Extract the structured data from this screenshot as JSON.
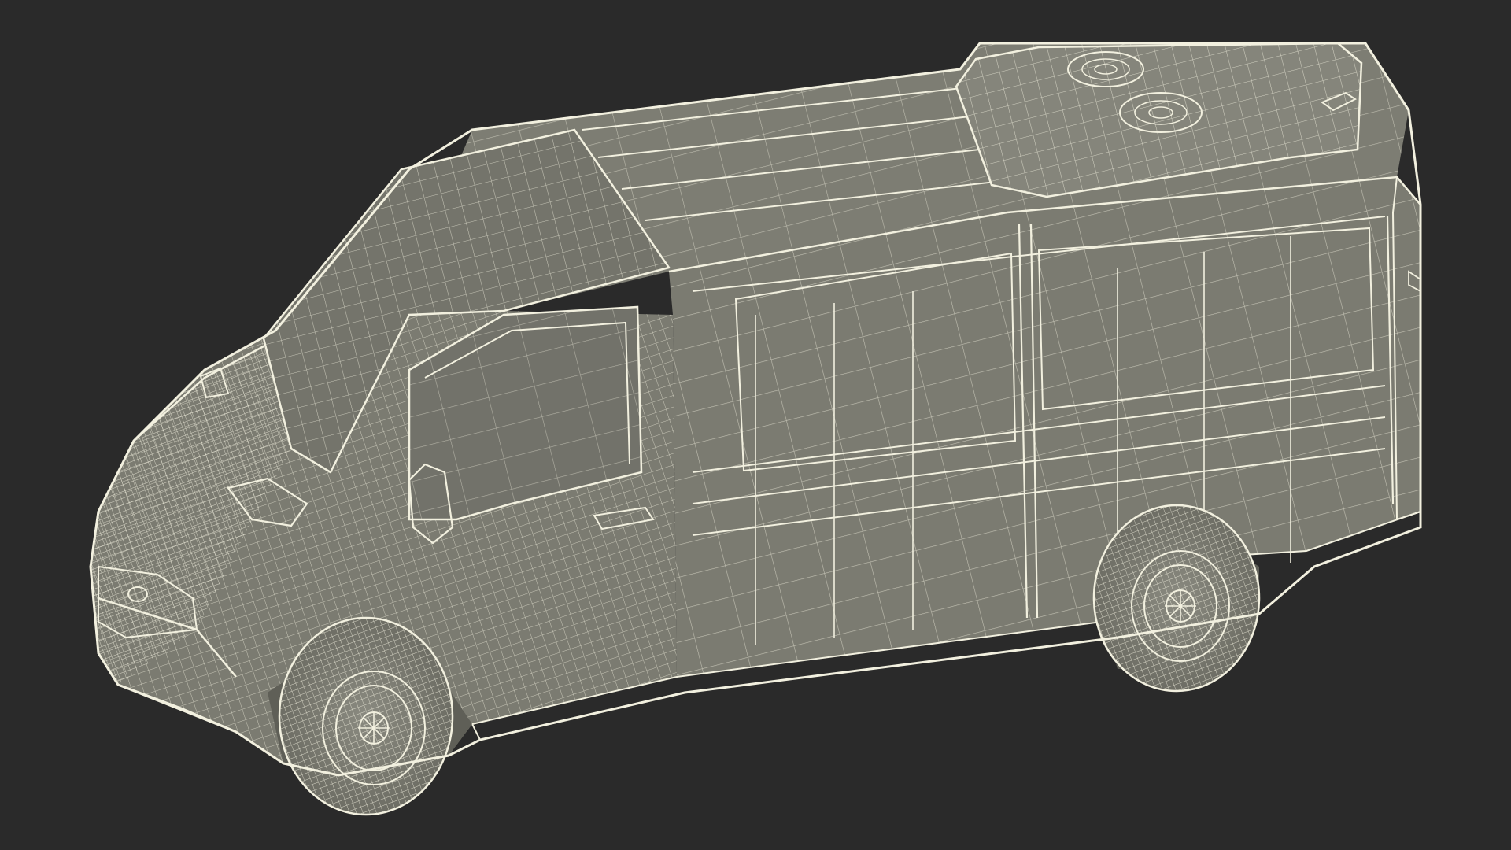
{
  "scene": {
    "subject": "van-wireframe-render",
    "colors": {
      "background": "#2a2a2a",
      "surface": "#7b7b71",
      "surface_dark": "#6b6b62",
      "glass": "#74746b",
      "wireframe": "#f2f0df",
      "tire": "#808076"
    }
  }
}
